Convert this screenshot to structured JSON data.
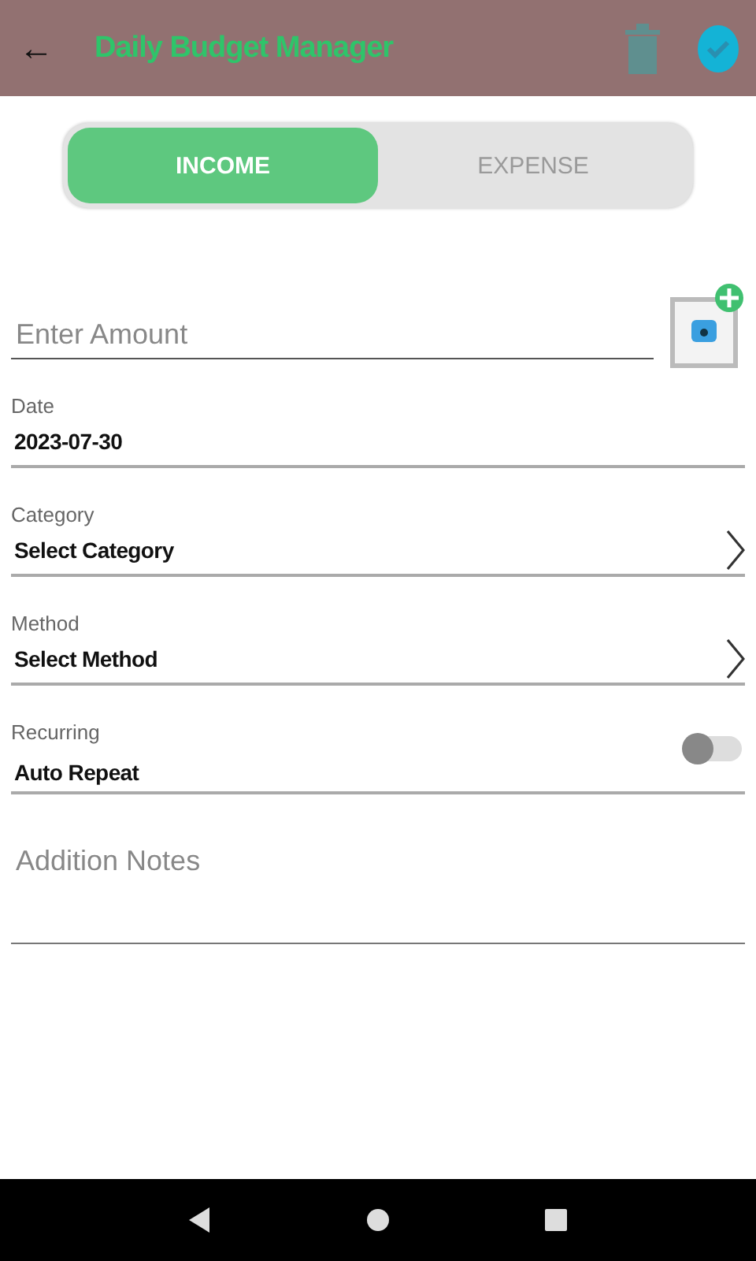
{
  "app_bar": {
    "back_icon": "←",
    "title": "Daily Budget Manager"
  },
  "type_toggle": [
    {
      "label": "INCOME",
      "selected": true
    },
    {
      "label": "EXPENSE",
      "selected": false
    }
  ],
  "fields": [
    {
      "kind": "amount",
      "placeholder": "Enter Amount"
    },
    {
      "kind": "text",
      "label": "Date",
      "value": "2023-07-30"
    },
    {
      "kind": "select",
      "label": "Category",
      "value": "Select Category"
    },
    {
      "kind": "select",
      "label": "Method",
      "value": "Select Method"
    },
    {
      "kind": "switch",
      "label": "Recurring",
      "value": "Auto Repeat",
      "on": false
    },
    {
      "kind": "notes",
      "placeholder": "Addition Notes"
    }
  ]
}
